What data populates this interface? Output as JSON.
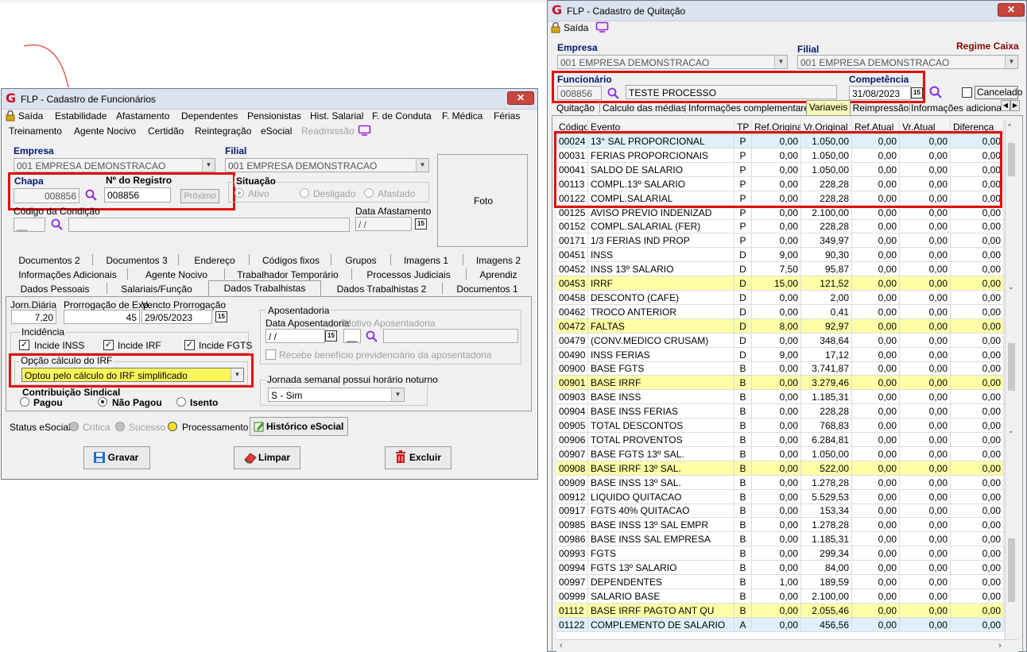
{
  "left_window": {
    "title": "FLP - Cadastro de Funcionários",
    "menu_row1": [
      "Saída",
      "Estabilidade",
      "Afastamento",
      "Dependentes",
      "Pensionistas",
      "Hist. Salarial",
      "F. de Conduta",
      "F. Médica",
      "Férias"
    ],
    "menu_row2": [
      "Treinamento",
      "Agente Nocivo",
      "Certidão",
      "Reintegração",
      "eSocial",
      "Readmissão"
    ],
    "empresa_label": "Empresa",
    "empresa_value": "001 EMPRESA DEMONSTRACAO",
    "filial_label": "Filial",
    "filial_value": "001 EMPRESA DEMONSTRACAO",
    "chapa_label": "Chapa",
    "chapa_value": "008856",
    "registro_label": "Nº do Registro",
    "registro_value": "008856",
    "proximo_button": "Próximo",
    "situacao_label": "Situação",
    "situacao_options": [
      "Ativo",
      "Desligado",
      "Afastado"
    ],
    "foto_label": "Foto",
    "codigo_condicao_label": "Código da Condição",
    "data_afastamento_label": "Data Afastamento",
    "data_afastamento_value": " /  / ",
    "date_icon": "15",
    "tabs_row1": [
      "Documentos 2",
      "Documentos 3",
      "Endereço",
      "Códigos fixos",
      "Grupos",
      "Imagens 1",
      "Imagens 2"
    ],
    "tabs_row2": [
      "Informações Adicionais",
      "Agente Nocivo",
      "Trabalhador Temporário",
      "Processos Judiciais",
      "Aprendiz"
    ],
    "tabs_row3": [
      "Dados Pessoais",
      "Salariais/Função",
      "Dados Trabalhistas",
      "Dados Trabalhistas 2",
      "Documentos 1"
    ],
    "jorn_diaria_label": "Jorn.Diária",
    "jorn_diaria_value": "7,20",
    "prorrogacao_label": "Prorrogação de Exp.",
    "prorrogacao_value": "45",
    "vencto_label": "Vencto Prorrogação",
    "vencto_value": "29/05/2023",
    "incidencia_label": "Incidência",
    "incide_inss": "Incide INSS",
    "incide_irf": "Incide IRF",
    "incide_fgts": "Incide FGTS",
    "opcao_irf_label": "Opção cálculo do IRF",
    "opcao_irf_value": "Optou pelo cálculo do IRF simplificado",
    "contribuicao_label": "Contribuição Sindical",
    "contribuicao_options": [
      "Pagou",
      "Não Pagou",
      "Isento"
    ],
    "aposentadoria_label": "Aposentadoria",
    "data_aposentadoria_label": "Data Aposentadoria",
    "motivo_aposentadoria_label": "Motivo Aposentadoria",
    "data_aposentadoria_value": " /  / ",
    "recebe_beneficio_label": "Recebe benefício previdenciário da aposentadoria",
    "jornada_label": "Jornada semanal possui horário noturno",
    "jornada_value": "S - Sim",
    "status_esocial_label": "Status eSocial:",
    "status_options": [
      "Crítica",
      "Sucesso",
      "Processamento"
    ],
    "status_colors": [
      "#c0c0c0",
      "#c0c0c0",
      "#f7e21b"
    ],
    "historico_button": "Histórico eSocial",
    "gravar_button": "Gravar",
    "limpar_button": "Limpar",
    "excluir_button": "Excluir"
  },
  "right_window": {
    "title": "FLP - Cadastro de Quitação",
    "saida_label": "Saída",
    "empresa_label": "Empresa",
    "empresa_value": "001 EMPRESA DEMONSTRACAO",
    "filial_label": "Filial",
    "filial_value": "001 EMPRESA DEMONSTRACAO",
    "regime_label": "Regime Caixa",
    "funcionario_label": "Funcionário",
    "funcionario_code": "008856",
    "funcionario_name": "TESTE PROCESSO",
    "competencia_label": "Competência",
    "competencia_value": "31/08/2023",
    "cancelado_label": "Cancelado",
    "tabs": [
      "Quitação",
      "Calculo das médias",
      "Informações complementares",
      "Variaveis",
      "Reimpressão",
      "Informações adicionais"
    ],
    "grid_headers": [
      "Código",
      "Evento",
      "TP",
      "Ref.Original",
      "Vr.Original",
      "Ref.Atual",
      "Vr.Atual",
      "Diferença"
    ],
    "highlight_color": "#ffffa6",
    "rows": [
      [
        "00024",
        "13° SAL PROPORCIONAL",
        "P",
        "0,00",
        "1.050,00",
        "0,00",
        "0,00",
        "0,00"
      ],
      [
        "00031",
        "FERIAS PROPORCIONAIS",
        "P",
        "0,00",
        "1.050,00",
        "0,00",
        "0,00",
        "0,00"
      ],
      [
        "00041",
        "SALDO DE SALARIO",
        "P",
        "0,00",
        "1.050,00",
        "0,00",
        "0,00",
        "0,00"
      ],
      [
        "00113",
        "COMPL.13º SALARIO",
        "P",
        "0,00",
        "228,28",
        "0,00",
        "0,00",
        "0,00"
      ],
      [
        "00122",
        "COMPL.SALARIAL",
        "P",
        "0,00",
        "228,28",
        "0,00",
        "0,00",
        "0,00"
      ],
      [
        "00125",
        "AVISO PREVIO INDENIZAD",
        "P",
        "0,00",
        "2.100,00",
        "0,00",
        "0,00",
        "0,00"
      ],
      [
        "00152",
        "COMPL.SALARIAL (FER)",
        "P",
        "0,00",
        "228,28",
        "0,00",
        "0,00",
        "0,00"
      ],
      [
        "00171",
        "1/3 FERIAS IND PROP",
        "P",
        "0,00",
        "349,97",
        "0,00",
        "0,00",
        "0,00"
      ],
      [
        "00451",
        "INSS",
        "D",
        "9,00",
        "90,30",
        "0,00",
        "0,00",
        "0,00"
      ],
      [
        "00452",
        "INSS 13º SALARIO",
        "D",
        "7,50",
        "95,87",
        "0,00",
        "0,00",
        "0,00"
      ],
      [
        "00453",
        "IRRF",
        "D",
        "15,00",
        "121,52",
        "0,00",
        "0,00",
        "0,00"
      ],
      [
        "00458",
        "DESCONTO (CAFE)",
        "D",
        "0,00",
        "2,00",
        "0,00",
        "0,00",
        "0,00"
      ],
      [
        "00462",
        "TROCO ANTERIOR",
        "D",
        "0,00",
        "0,41",
        "0,00",
        "0,00",
        "0,00"
      ],
      [
        "00472",
        "FALTAS",
        "D",
        "8,00",
        "92,97",
        "0,00",
        "0,00",
        "0,00"
      ],
      [
        "00479",
        "(CONV.MEDICO CRUSAM)",
        "D",
        "0,00",
        "348,64",
        "0,00",
        "0,00",
        "0,00"
      ],
      [
        "00490",
        "INSS FERIAS",
        "D",
        "9,00",
        "17,12",
        "0,00",
        "0,00",
        "0,00"
      ],
      [
        "00900",
        "BASE FGTS",
        "B",
        "0,00",
        "3.741,87",
        "0,00",
        "0,00",
        "0,00"
      ],
      [
        "00901",
        "BASE IRRF",
        "B",
        "0,00",
        "3.279,46",
        "0,00",
        "0,00",
        "0,00"
      ],
      [
        "00903",
        "BASE INSS",
        "B",
        "0,00",
        "1.185,31",
        "0,00",
        "0,00",
        "0,00"
      ],
      [
        "00904",
        "BASE INSS FERIAS",
        "B",
        "0,00",
        "228,28",
        "0,00",
        "0,00",
        "0,00"
      ],
      [
        "00905",
        "TOTAL DESCONTOS",
        "B",
        "0,00",
        "768,83",
        "0,00",
        "0,00",
        "0,00"
      ],
      [
        "00906",
        "TOTAL PROVENTOS",
        "B",
        "0,00",
        "6.284,81",
        "0,00",
        "0,00",
        "0,00"
      ],
      [
        "00907",
        "BASE FGTS 13º SAL.",
        "B",
        "0,00",
        "1.050,00",
        "0,00",
        "0,00",
        "0,00"
      ],
      [
        "00908",
        "BASE IRRF 13º SAL.",
        "B",
        "0,00",
        "522,00",
        "0,00",
        "0,00",
        "0,00"
      ],
      [
        "00909",
        "BASE INSS 13º SAL.",
        "B",
        "0,00",
        "1.278,28",
        "0,00",
        "0,00",
        "0,00"
      ],
      [
        "00912",
        "LIQUIDO QUITACAO",
        "B",
        "0,00",
        "5.529,53",
        "0,00",
        "0,00",
        "0,00"
      ],
      [
        "00917",
        "FGTS 40% QUITACAO",
        "B",
        "0,00",
        "153,34",
        "0,00",
        "0,00",
        "0,00"
      ],
      [
        "00985",
        "BASE INSS 13º SAL EMPR",
        "B",
        "0,00",
        "1.278,28",
        "0,00",
        "0,00",
        "0,00"
      ],
      [
        "00986",
        "BASE INSS SAL EMPRESA",
        "B",
        "0,00",
        "1.185,31",
        "0,00",
        "0,00",
        "0,00"
      ],
      [
        "00993",
        "FGTS",
        "B",
        "0,00",
        "299,34",
        "0,00",
        "0,00",
        "0,00"
      ],
      [
        "00994",
        "FGTS 13º SALARIO",
        "B",
        "0,00",
        "84,00",
        "0,00",
        "0,00",
        "0,00"
      ],
      [
        "00997",
        "DEPENDENTES",
        "B",
        "1,00",
        "189,59",
        "0,00",
        "0,00",
        "0,00"
      ],
      [
        "00999",
        "SALARIO BASE",
        "B",
        "0,00",
        "2.100,00",
        "0,00",
        "0,00",
        "0,00"
      ],
      [
        "01112",
        "BASE IRRF PAGTO ANT QU",
        "B",
        "0,00",
        "2.055,46",
        "0,00",
        "0,00",
        "0,00"
      ],
      [
        "01122",
        "COMPLEMENTO DE SALARIO",
        "A",
        "0,00",
        "456,56",
        "0,00",
        "0,00",
        "0,00"
      ]
    ],
    "highlighted_rows": [
      10,
      13,
      17,
      23,
      33
    ],
    "selected_rows": [
      0,
      34
    ]
  }
}
